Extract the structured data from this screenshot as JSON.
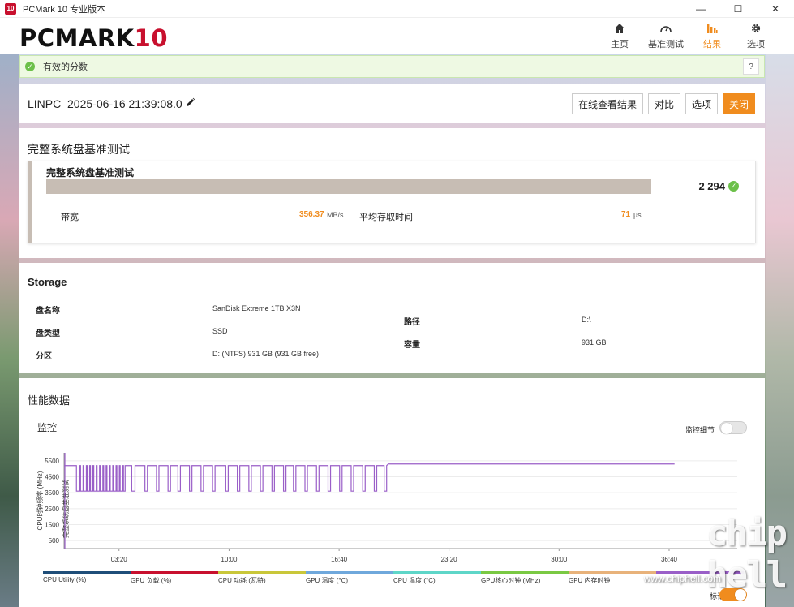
{
  "window": {
    "title": "PCMark 10 专业版本",
    "icon_text": "10",
    "controls": [
      "—",
      "☐",
      "✕"
    ]
  },
  "header": {
    "logo_main": "PCMARK",
    "logo_num": "10",
    "nav": [
      {
        "label": "主页",
        "icon": "home-icon"
      },
      {
        "label": "基准测试",
        "icon": "gauge-icon"
      },
      {
        "label": "结果",
        "icon": "bar-chart-icon",
        "active": true
      },
      {
        "label": "选项",
        "icon": "gear-icon"
      }
    ]
  },
  "banner": {
    "text": "有效的分数",
    "help": "?"
  },
  "result": {
    "name": "LINPC_2025-06-16 21:39:08.0",
    "buttons": {
      "view_online": "在线查看结果",
      "compare": "对比",
      "options": "选项",
      "close": "关闭"
    }
  },
  "test": {
    "section_title": "完整系统盘基准测试",
    "card_title": "完整系统盘基准测试",
    "score": "2 294",
    "metrics": [
      {
        "label": "带宽",
        "value": "356.37",
        "unit": "MB/s"
      },
      {
        "label": "平均存取时间",
        "value": "71",
        "unit": "μs"
      }
    ]
  },
  "storage": {
    "title": "Storage",
    "left": [
      {
        "label": "盘名称",
        "value": "SanDisk Extreme 1TB X3N"
      },
      {
        "label": "盘类型",
        "value": "SSD"
      },
      {
        "label": "分区",
        "value": "D: (NTFS) 931 GB (931 GB free)"
      }
    ],
    "right": [
      {
        "label": "路径",
        "value": "D:\\"
      },
      {
        "label": "容量",
        "value": "931 GB"
      }
    ]
  },
  "performance": {
    "title": "性能数据",
    "monitor_title": "监控",
    "monitor_detail_label": "监控细节",
    "monitor_detail_on": false,
    "mark_label": "标记",
    "mark_on": true,
    "legend": [
      {
        "label": "CPU Utility (%)",
        "color": "#1f4e79"
      },
      {
        "label": "GPU 负载 (%)",
        "color": "#c8102e"
      },
      {
        "label": "CPU 功耗 (瓦特)",
        "color": "#c9c73a"
      },
      {
        "label": "GPU 温度 (°C)",
        "color": "#6fa8dc"
      },
      {
        "label": "CPU 温度 (°C)",
        "color": "#5ed6c8"
      },
      {
        "label": "GPU核心时钟 (MHz)",
        "color": "#7ac943"
      },
      {
        "label": "GPU 内存时钟",
        "color": "#e8b27a"
      },
      {
        "label": "",
        "color": "#9a5fc8"
      }
    ]
  },
  "chart_data": {
    "type": "line",
    "ylabel": "CPU时钟频率 (MHz)",
    "secondary_label": "完整系统盘基准测试",
    "ylim": [
      0,
      6000
    ],
    "yticks": [
      "5500",
      "4500",
      "3500",
      "2500",
      "1500",
      "500"
    ],
    "ytick_values": [
      5500,
      4500,
      3500,
      2500,
      1500,
      500
    ],
    "xticks": [
      "03:20",
      "10:00",
      "16:40",
      "23:20",
      "30:00",
      "36:40"
    ],
    "xtick_values_min": [
      3.33,
      10.0,
      16.67,
      23.33,
      30.0,
      36.67
    ],
    "xlim_min": [
      0,
      40.8
    ],
    "series": [
      {
        "color": "#9a5fc8",
        "baseline_mhz": 5200,
        "low_mhz": 3600,
        "stable_mhz": 5300,
        "dip_segments_min": [
          [
            0.75,
            0.95
          ],
          [
            1.0,
            1.15
          ],
          [
            1.2,
            1.35
          ],
          [
            1.4,
            1.55
          ],
          [
            1.6,
            1.75
          ],
          [
            1.8,
            1.95
          ],
          [
            2.0,
            2.15
          ],
          [
            2.2,
            2.35
          ],
          [
            2.4,
            2.55
          ],
          [
            2.6,
            2.75
          ],
          [
            2.8,
            2.95
          ],
          [
            3.0,
            3.15
          ],
          [
            3.2,
            3.35
          ],
          [
            3.4,
            3.55
          ],
          [
            3.6,
            3.7
          ],
          [
            4.1,
            4.3
          ],
          [
            4.9,
            5.05
          ],
          [
            5.6,
            5.75
          ],
          [
            6.3,
            6.45
          ],
          [
            6.9,
            7.05
          ],
          [
            7.6,
            7.75
          ],
          [
            8.3,
            8.45
          ],
          [
            9.0,
            9.15
          ],
          [
            9.8,
            9.95
          ],
          [
            10.5,
            10.65
          ],
          [
            11.2,
            11.35
          ],
          [
            11.9,
            12.05
          ],
          [
            12.6,
            12.75
          ],
          [
            13.3,
            13.45
          ],
          [
            13.9,
            14.05
          ],
          [
            14.6,
            14.75
          ],
          [
            15.3,
            15.45
          ],
          [
            16.0,
            16.15
          ],
          [
            16.7,
            16.85
          ],
          [
            17.4,
            17.55
          ],
          [
            18.1,
            18.25
          ],
          [
            18.8,
            18.95
          ],
          [
            19.4,
            19.55
          ]
        ],
        "end_min": 37.0
      }
    ]
  }
}
